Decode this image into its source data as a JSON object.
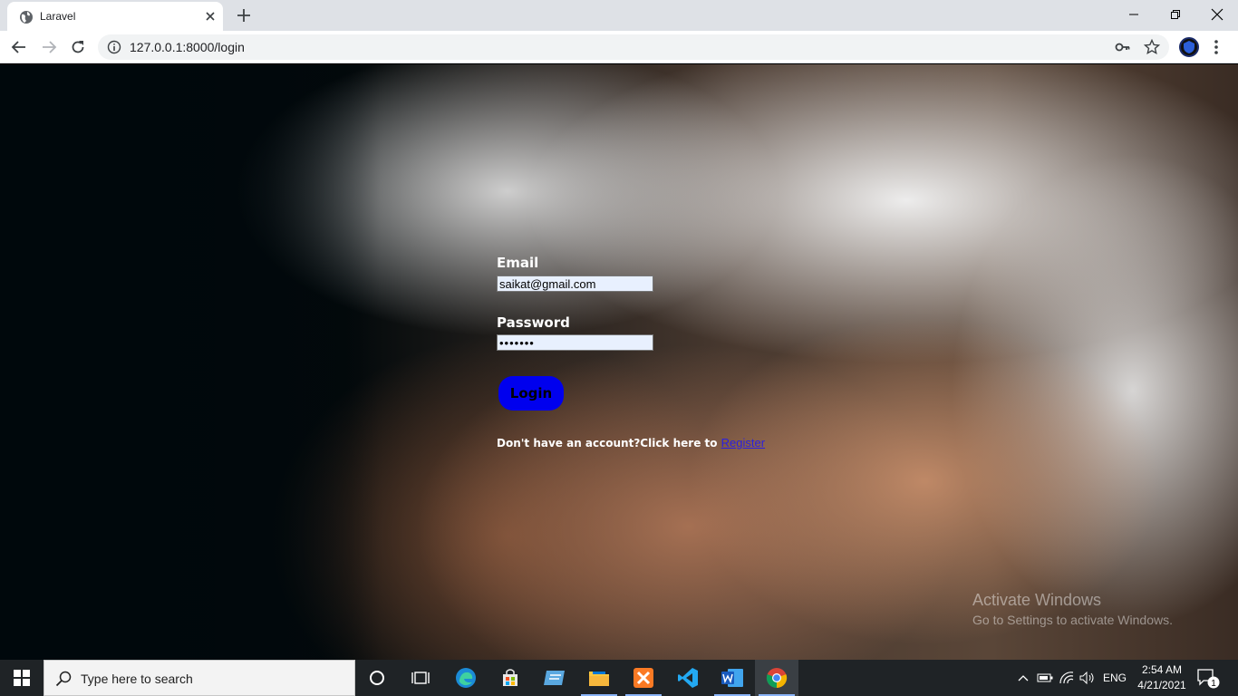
{
  "browser": {
    "tab_title": "Laravel",
    "url": "127.0.0.1:8000/login"
  },
  "form": {
    "email_label": "Email",
    "email_value": "saikat@gmail.com",
    "password_label": "Password",
    "password_value": "•••••••",
    "login_button": "Login",
    "register_prompt": "Don't have an account?Click here to ",
    "register_link": "Register"
  },
  "watermark": {
    "title": "Activate Windows",
    "subtitle": "Go to Settings to activate Windows."
  },
  "taskbar": {
    "search_placeholder": "Type here to search",
    "language": "ENG",
    "time": "2:54 AM",
    "date": "4/21/2021",
    "notification_count": "1"
  },
  "colors": {
    "login_button": "#0000ee",
    "link": "#2a1fe0",
    "input_background": "#e8f0fe"
  }
}
